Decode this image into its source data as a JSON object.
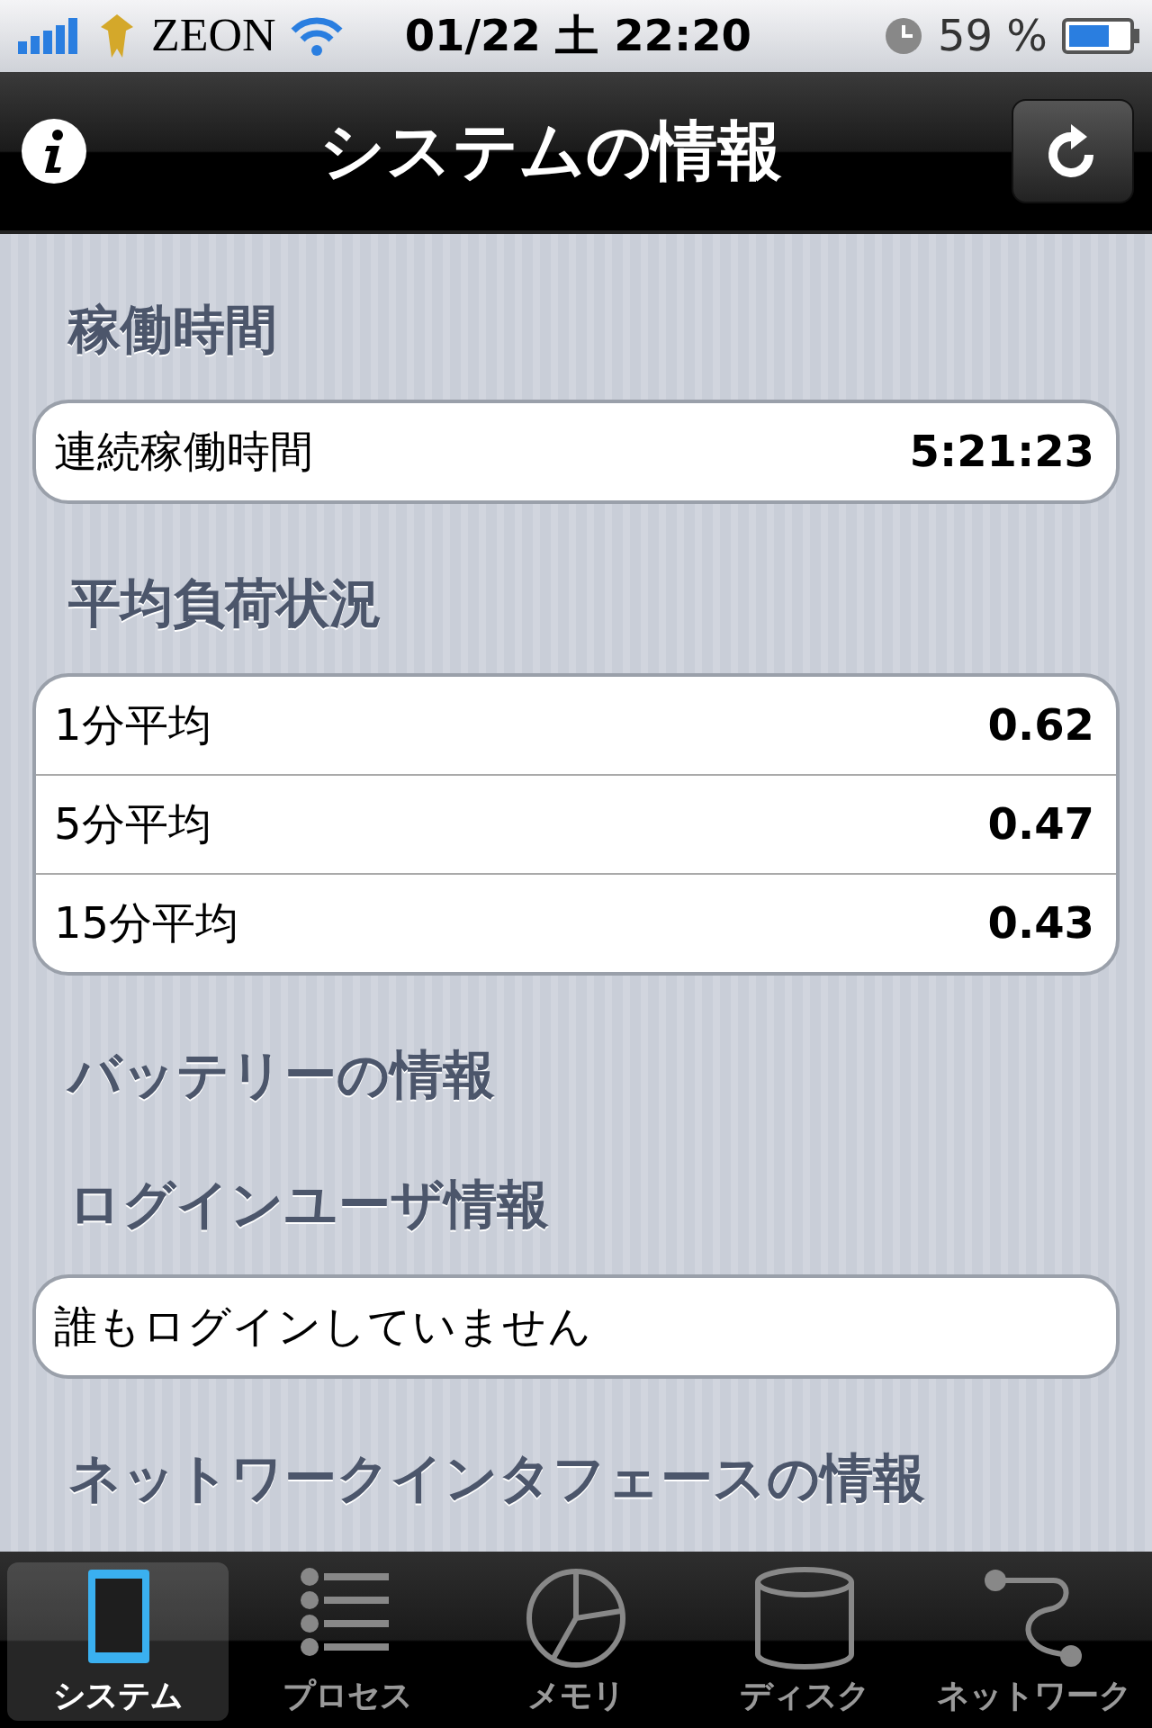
{
  "status_bar": {
    "carrier": "ZEON",
    "datetime": "01/22 土 22:20",
    "battery": "59 %"
  },
  "nav_bar": {
    "title": "システムの情報"
  },
  "sections": [
    {
      "title": "稼働時間",
      "rows": [
        {
          "label": "連続稼働時間",
          "value": "5:21:23"
        }
      ]
    },
    {
      "title": "平均負荷状況",
      "rows": [
        {
          "label": "1分平均",
          "value": "0.62"
        },
        {
          "label": "5分平均",
          "value": "0.47"
        },
        {
          "label": "15分平均",
          "value": "0.43"
        }
      ]
    },
    {
      "title": "バッテリーの情報"
    },
    {
      "title": "ログインユーザ情報",
      "rows": [
        {
          "label": "誰もログインしていません"
        }
      ]
    },
    {
      "title": "ネットワークインタフェースの情報"
    }
  ],
  "tab_bar": [
    {
      "label": "システム",
      "kind": "phone",
      "selected": true
    },
    {
      "label": "プロセス",
      "kind": "list",
      "selected": false
    },
    {
      "label": "メモリ",
      "kind": "pie",
      "selected": false
    },
    {
      "label": "ディスク",
      "kind": "disk",
      "selected": false
    },
    {
      "label": "ネットワーク",
      "kind": "network",
      "selected": false
    }
  ]
}
